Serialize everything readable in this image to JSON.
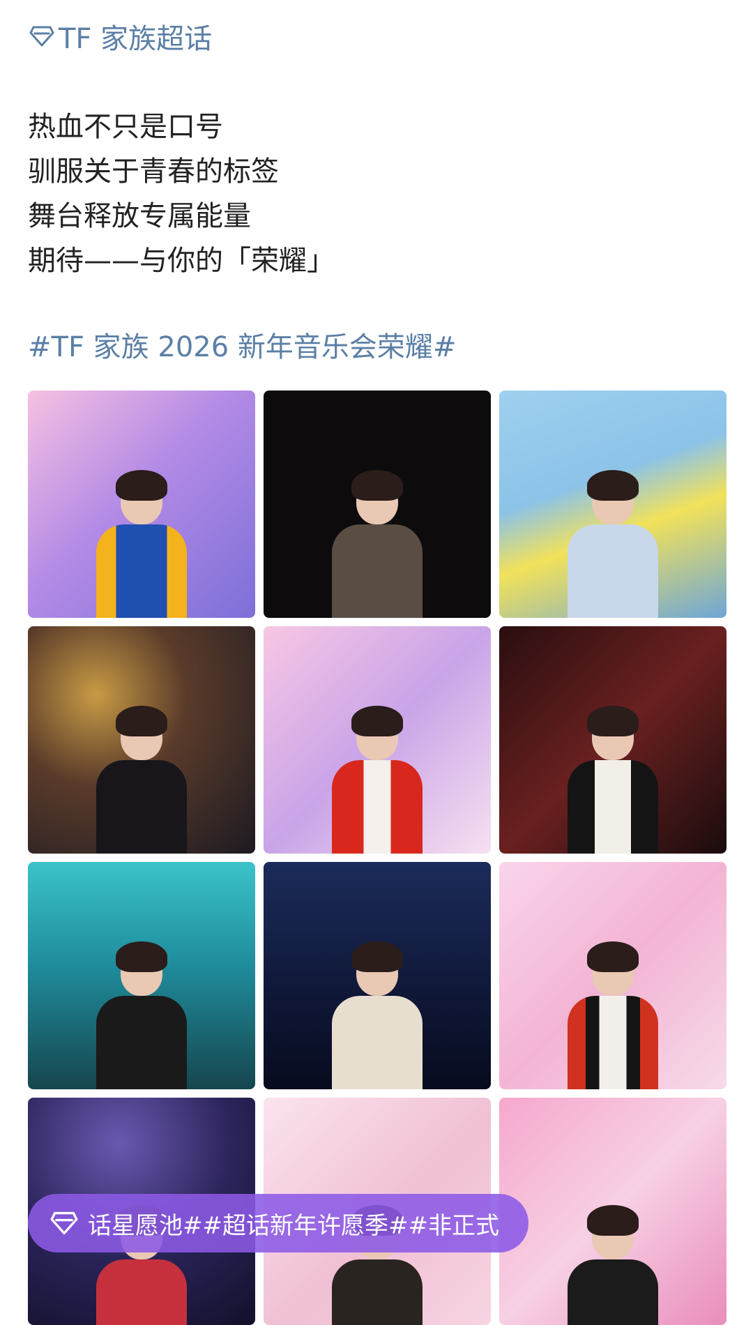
{
  "topic": {
    "label": "TF 家族超话",
    "icon": "super-topic-diamond-icon"
  },
  "post": {
    "lines": [
      "热血不只是口号",
      "驯服关于青春的标签",
      "舞台释放专属能量",
      "期待——与你的「荣耀」"
    ],
    "hashtag": "#TF 家族 2026 新年音乐会荣耀#"
  },
  "photos": {
    "count_visible": 12,
    "items": [
      "photo-1",
      "photo-2",
      "photo-3",
      "photo-4",
      "photo-5",
      "photo-6",
      "photo-7",
      "photo-8",
      "photo-9",
      "photo-10",
      "photo-11",
      "photo-12"
    ]
  },
  "floating_bar": {
    "icon": "super-topic-diamond-icon",
    "text": "话星愿池##超话新年许愿季##非正式"
  },
  "colors": {
    "link": "#5b7fa6",
    "text": "#222222",
    "pill_bg": "#8c5ae6"
  }
}
